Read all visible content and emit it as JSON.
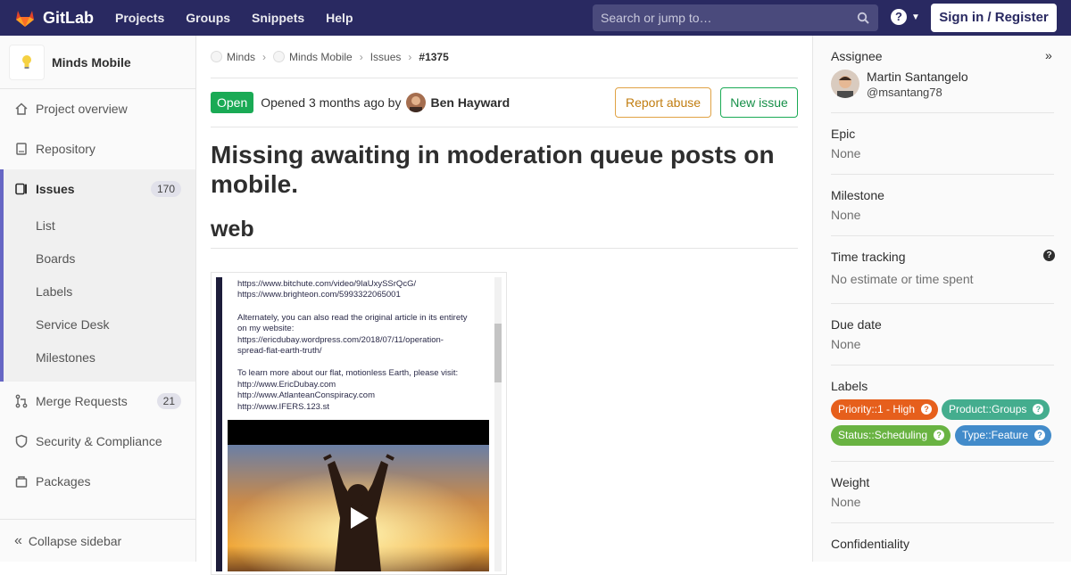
{
  "topbar": {
    "logo_text": "GitLab",
    "nav": [
      "Projects",
      "Groups",
      "Snippets",
      "Help"
    ],
    "search_placeholder": "Search or jump to…",
    "help_glyph": "?",
    "signin_label": "Sign in / Register"
  },
  "sidebar": {
    "project_name": "Minds Mobile",
    "items": [
      {
        "label": "Project overview",
        "icon": "home-icon"
      },
      {
        "label": "Repository",
        "icon": "doc-icon"
      },
      {
        "label": "Issues",
        "icon": "issues-icon",
        "count": "170"
      },
      {
        "label": "Merge Requests",
        "icon": "merge-request-icon",
        "count": "21"
      },
      {
        "label": "Security & Compliance",
        "icon": "shield-icon"
      },
      {
        "label": "Packages",
        "icon": "package-icon"
      }
    ],
    "issue_subitems": [
      "List",
      "Boards",
      "Labels",
      "Service Desk",
      "Milestones"
    ],
    "collapse_label": "Collapse sidebar"
  },
  "breadcrumb": {
    "items": [
      "Minds",
      "Minds Mobile",
      "Issues"
    ],
    "current": "#1375"
  },
  "issue": {
    "status": "Open",
    "opened_text": "Opened 3 months ago by",
    "author": "Ben Hayward",
    "report_label": "Report abuse",
    "new_label": "New issue",
    "title": "Missing awaiting in moderation queue posts on mobile.",
    "section_heading": "web",
    "screenshot_lines": [
      "https://www.bitchute.com/video/9laUxySSrQcG/",
      "https://www.brighteon.com/5993322065001",
      "Alternately, you can also read the original article in its entirety",
      "on my website:",
      "https://ericdubay.wordpress.com/2018/07/11/operation-",
      "spread-flat-earth-truth/",
      "To learn more about our flat, motionless Earth, please visit:",
      "http://www.EricDubay.com",
      "http://www.AtlanteanConspiracy.com",
      "http://www.IFERS.123.st"
    ]
  },
  "right": {
    "assignee_heading": "Assignee",
    "assignee_name": "Martin Santangelo",
    "assignee_handle": "@msantang78",
    "epic_heading": "Epic",
    "epic_value": "None",
    "milestone_heading": "Milestone",
    "milestone_value": "None",
    "time_heading": "Time tracking",
    "time_value": "No estimate or time spent",
    "due_heading": "Due date",
    "due_value": "None",
    "labels_heading": "Labels",
    "labels": [
      {
        "text": "Priority::1 - High",
        "color": "#e65f1c"
      },
      {
        "text": "Product::Groups",
        "color": "#44ad8e"
      },
      {
        "text": "Status::Scheduling",
        "color": "#69b342"
      },
      {
        "text": "Type::Feature",
        "color": "#428bca"
      }
    ],
    "weight_heading": "Weight",
    "weight_value": "None",
    "conf_heading": "Confidentiality"
  },
  "colors": {
    "topbar": "#292961",
    "open": "#1aaa55",
    "sidebar_active": "#6666c4"
  }
}
